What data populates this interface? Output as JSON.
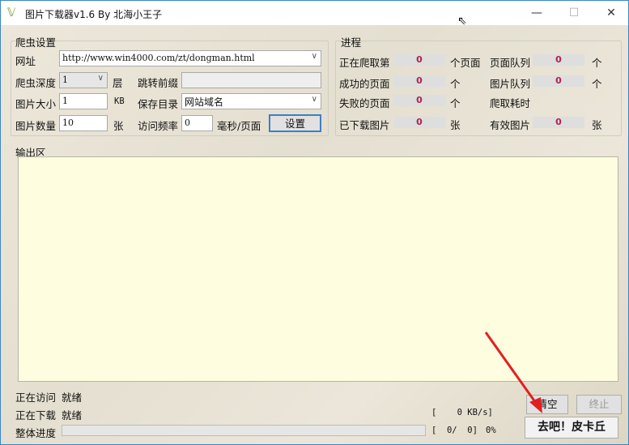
{
  "window": {
    "title": "图片下载器v1.6 By 北海小王子",
    "minimize": "—",
    "maximize": "☐",
    "close": "✕"
  },
  "settings": {
    "group_label": "爬虫设置",
    "url_label": "网址",
    "url_value": "http://www.win4000.com/zt/dongman.html",
    "depth_label": "爬虫深度",
    "depth_value": "1",
    "depth_unit": "层",
    "jump_prefix_label": "跳转前缀",
    "jump_prefix_value": "",
    "size_label": "图片大小",
    "size_value": "1",
    "size_unit": "KB",
    "save_dir_label": "保存目录",
    "save_dir_value": "网站域名",
    "count_label": "图片数量",
    "count_value": "10",
    "count_unit": "张",
    "freq_label": "访问频率",
    "freq_value": "0",
    "freq_unit": "毫秒/页面",
    "set_button": "设置"
  },
  "progress": {
    "group_label": "进程",
    "crawling_label": "正在爬取第",
    "crawling_value": "0",
    "crawling_unit": "个页面",
    "page_queue_label": "页面队列",
    "page_queue_value": "0",
    "page_queue_unit": "个",
    "success_label": "成功的页面",
    "success_value": "0",
    "success_unit": "个",
    "image_queue_label": "图片队列",
    "image_queue_value": "0",
    "image_queue_unit": "个",
    "failed_label": "失败的页面",
    "failed_value": "0",
    "failed_unit": "个",
    "elapsed_label": "爬取耗时",
    "downloaded_label": "已下载图片",
    "downloaded_value": "0",
    "downloaded_unit": "张",
    "valid_label": "有效图片",
    "valid_value": "0",
    "valid_unit": "张"
  },
  "output": {
    "label": "输出区",
    "content": ""
  },
  "status": {
    "visiting_label": "正在访问",
    "visiting_value": "就绪",
    "downloading_label": "正在下载",
    "downloading_value": "就绪",
    "overall_label": "整体进度",
    "overall_percent": 0,
    "speed_text": "[    0 KB/s]",
    "count_text": "[  0/  0]",
    "percent_text": "0%"
  },
  "buttons": {
    "clear": "清空",
    "stop": "终止",
    "go": "去吧！皮卡丘"
  },
  "colors": {
    "counter": "#b0214d",
    "output_bg": "#fffde0",
    "arrow": "#e02020"
  }
}
